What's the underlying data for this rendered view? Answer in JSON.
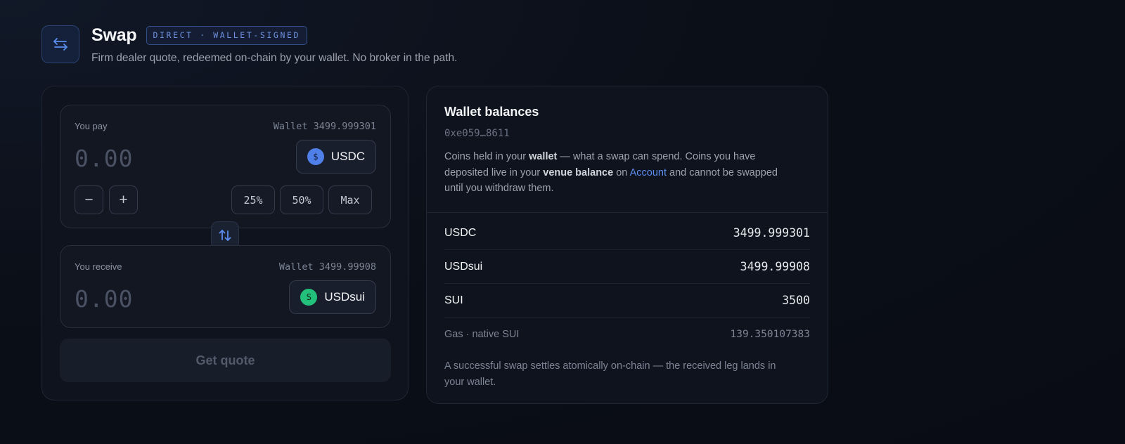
{
  "header": {
    "title": "Swap",
    "badge": "DIRECT · WALLET-SIGNED",
    "subtitle": "Firm dealer quote, redeemed on-chain by your wallet. No broker in the path.",
    "icon": "swap-arrows-icon"
  },
  "pay": {
    "label": "You pay",
    "wallet": "Wallet 3499.999301",
    "amount_placeholder": "0.00",
    "token": "USDC",
    "token_glyph": "$",
    "decrement": "−",
    "increment": "+",
    "pct_25": "25%",
    "pct_50": "50%",
    "pct_max": "Max"
  },
  "receive": {
    "label": "You receive",
    "wallet": "Wallet 3499.99908",
    "amount_placeholder": "0.00",
    "token": "USDsui",
    "token_glyph": "S"
  },
  "quote_button": "Get quote",
  "balances": {
    "title": "Wallet balances",
    "address": "0xe059…8611",
    "desc": {
      "p1": "Coins held in your ",
      "b1": "wallet",
      "p2": " — what a swap can spend. Coins you have deposited live in your ",
      "b2": "venue balance",
      "p3": " on ",
      "link": "Account",
      "p4": " and cannot be swapped until you withdraw them."
    },
    "rows": [
      {
        "token": "USDC",
        "amount": "3499.999301"
      },
      {
        "token": "USDsui",
        "amount": "3499.99908"
      },
      {
        "token": "SUI",
        "amount": "3500"
      }
    ],
    "gas": {
      "label": "Gas · native SUI",
      "amount": "139.350107383"
    },
    "footer": "A successful swap settles atomically on-chain — the received leg lands in your wallet."
  },
  "colors": {
    "accent": "#5b8def",
    "usdc": "#4f7fe8",
    "usdsui": "#22c07a",
    "background": "#0b0f18"
  }
}
